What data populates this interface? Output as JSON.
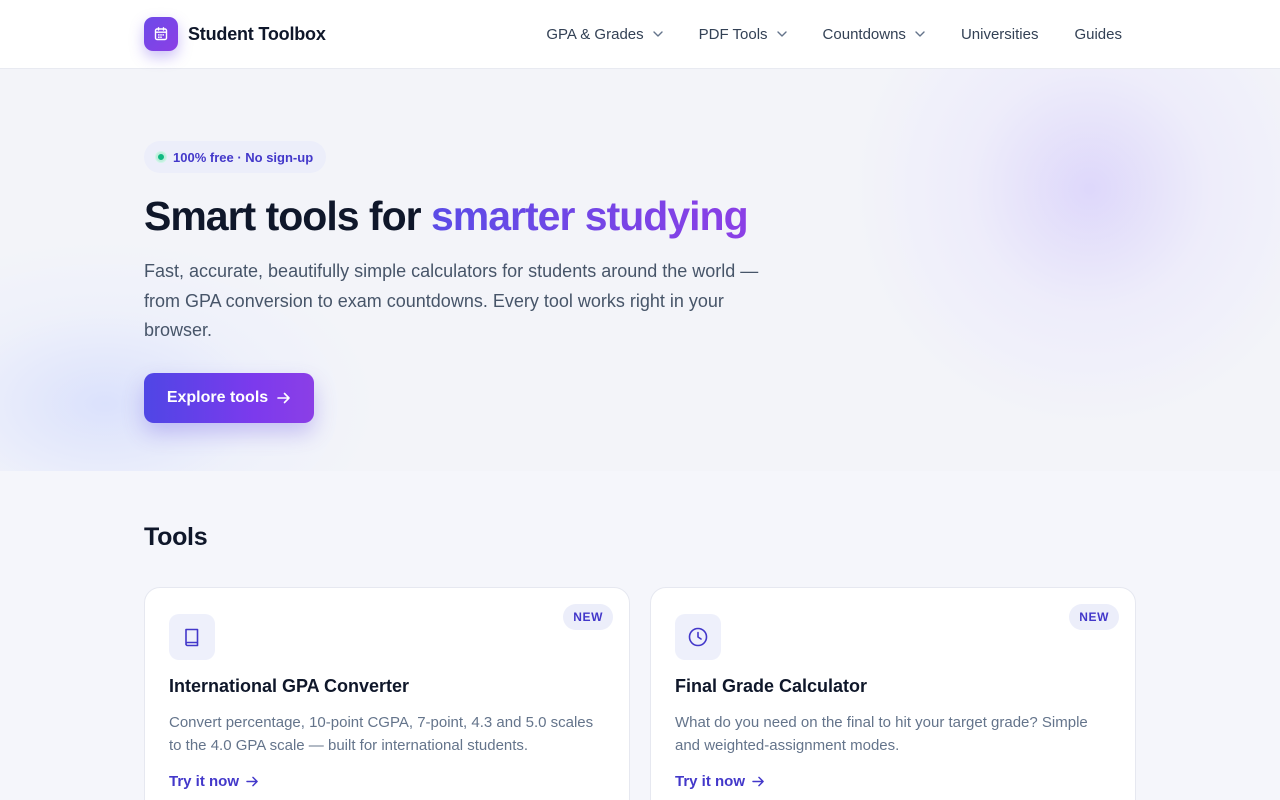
{
  "header": {
    "brand_name": "Student Toolbox",
    "logo_icon": "calendar-icon",
    "nav": [
      {
        "label": "GPA & Grades",
        "dropdown": true
      },
      {
        "label": "PDF Tools",
        "dropdown": true
      },
      {
        "label": "Countdowns",
        "dropdown": true
      },
      {
        "label": "Universities",
        "dropdown": false
      },
      {
        "label": "Guides",
        "dropdown": false
      }
    ]
  },
  "hero": {
    "badge": "100% free · No sign-up",
    "title_prefix": "Smart tools for ",
    "title_accent": "smarter studying",
    "subtitle": "Fast, accurate, beautifully simple calculators for students around the world — from GPA conversion to exam countdowns. Every tool works right in your browser.",
    "cta_label": "Explore tools"
  },
  "tools": {
    "heading": "Tools",
    "cards": [
      {
        "icon": "book-icon",
        "badge": "NEW",
        "title": "International GPA Converter",
        "description": "Convert percentage, 10-point CGPA, 7-point, 4.3 and 5.0 scales to the 4.0 GPA scale — built for international students.",
        "link": "Try it now"
      },
      {
        "icon": "clock-icon",
        "badge": "NEW",
        "title": "Final Grade Calculator",
        "description": "What do you need on the final to hit your target grade? Simple and weighted-assignment modes.",
        "link": "Try it now"
      }
    ]
  },
  "colors": {
    "accent_start": "#4f46e5",
    "accent_end": "#8b3fe6",
    "badge_text": "#4338ca",
    "status_dot": "#10b981"
  }
}
